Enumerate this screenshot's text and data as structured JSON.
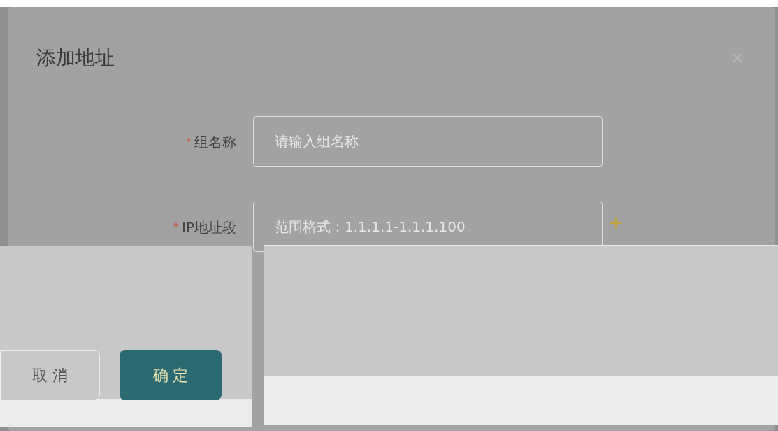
{
  "dialog": {
    "title": "添加地址",
    "fields": [
      {
        "label": "组名称",
        "required_mark": "*",
        "placeholder": "请输入组名称"
      },
      {
        "label": "IP地址段",
        "required_mark": "*",
        "placeholder": "范围格式：1.1.1.1-1.1.1.100"
      }
    ]
  },
  "buttons": [
    {
      "label": "取 消",
      "kind": "secondary"
    },
    {
      "label": "确 定",
      "kind": "primary"
    }
  ]
}
